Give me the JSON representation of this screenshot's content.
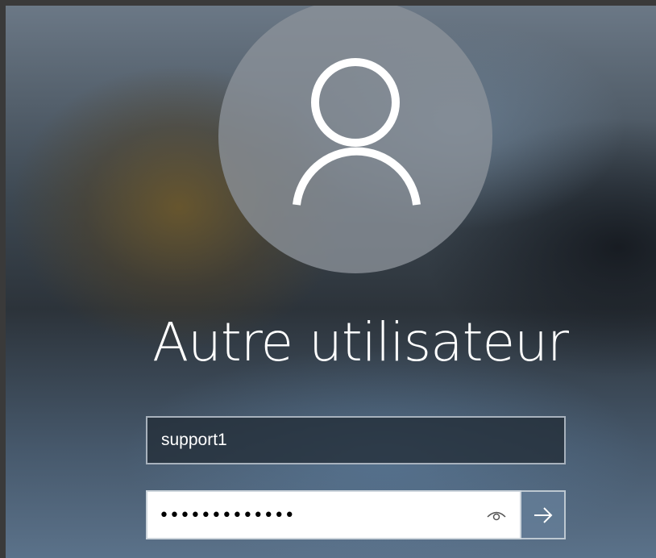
{
  "login": {
    "user_title": "Autre utilisateur",
    "username_value": "support1",
    "password_masked": "•••••••••••••",
    "icons": {
      "avatar": "user-avatar-icon",
      "reveal": "eye-icon",
      "submit": "arrow-right-icon"
    }
  }
}
